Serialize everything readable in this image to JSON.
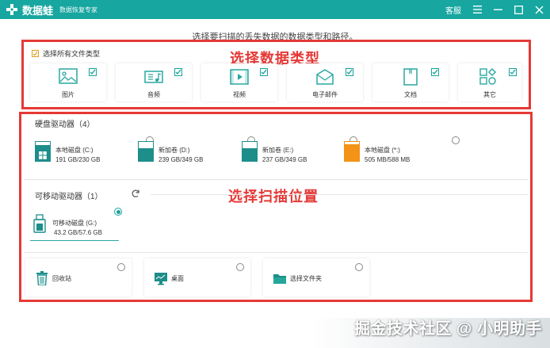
{
  "titlebar": {
    "app_name": "数据蛙",
    "subtitle": "数据恢复专家",
    "support_label": "客服"
  },
  "instruction": "选择要扫描的丢失数据的数据类型和路径。",
  "annotations": {
    "types": "选择数据类型",
    "location": "选择扫描位置"
  },
  "file_types": {
    "select_all_label": "选择所有文件类型",
    "select_all_checked": true,
    "items": [
      {
        "label": "图片",
        "icon": "image-icon",
        "checked": true
      },
      {
        "label": "音频",
        "icon": "audio-icon",
        "checked": true
      },
      {
        "label": "视频",
        "icon": "video-icon",
        "checked": true
      },
      {
        "label": "电子邮件",
        "icon": "email-icon",
        "checked": true
      },
      {
        "label": "文档",
        "icon": "document-icon",
        "checked": true
      },
      {
        "label": "其它",
        "icon": "other-icon",
        "checked": true
      }
    ]
  },
  "hard_drives": {
    "title": "硬盘驱动器（4）",
    "items": [
      {
        "name": "本地磁盘 (C:)",
        "size": "191 GB/230 GB",
        "used_fraction": 0.83,
        "color": "#1d8e8a",
        "system": true,
        "selected": false
      },
      {
        "name": "新加卷 (D:)",
        "size": "239 GB/349 GB",
        "used_fraction": 0.68,
        "color": "#1d8e8a",
        "system": false,
        "selected": false
      },
      {
        "name": "新加卷 (E:)",
        "size": "237 GB/349 GB",
        "used_fraction": 0.68,
        "color": "#1d8e8a",
        "system": false,
        "selected": false
      },
      {
        "name": "本地磁盘 (*:)",
        "size": "505 MB/588 MB",
        "used_fraction": 0.86,
        "color": "#f39317",
        "system": false,
        "selected": false
      }
    ]
  },
  "removable_drives": {
    "title": "可移动驱动器（1）",
    "items": [
      {
        "name": "可移动磁盘 (G:)",
        "size": "43.2 GB/57.6 GB",
        "selected": true
      }
    ]
  },
  "locations": [
    {
      "label": "回收站",
      "icon": "recycle-bin-icon",
      "selected": false
    },
    {
      "label": "桌面",
      "icon": "desktop-icon",
      "selected": false
    },
    {
      "label": "选择文件夹",
      "icon": "folder-icon",
      "selected": false
    }
  ],
  "watermark": "掘金技术社区 @ 小明助手",
  "colors": {
    "accent": "#17a6a0",
    "annotation_red": "#e53935",
    "warning_orange": "#f39317"
  }
}
